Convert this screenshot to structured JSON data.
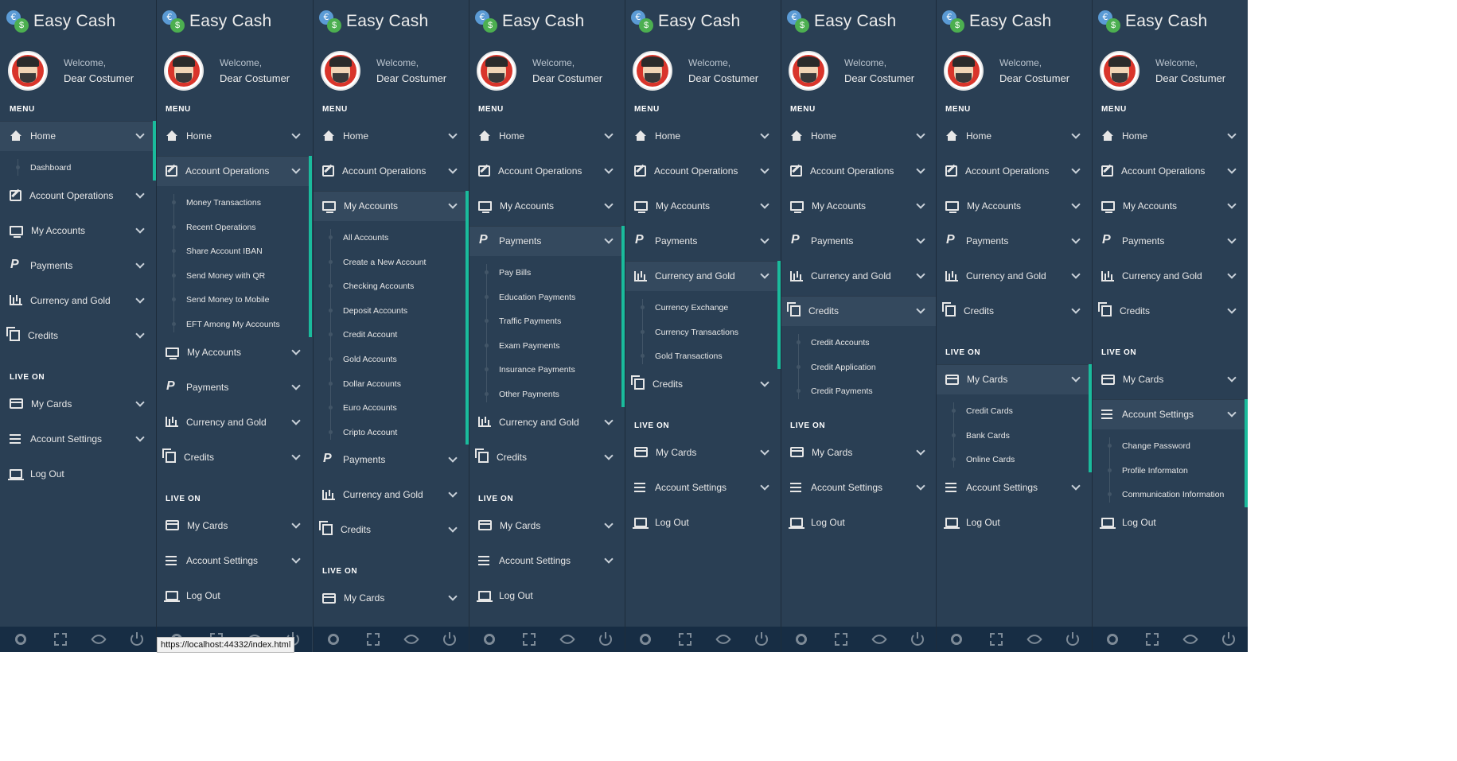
{
  "brand": {
    "name": "Easy Cash",
    "coin1": "€",
    "coin2": "$"
  },
  "user": {
    "welcome": "Welcome,",
    "name": "Dear Costumer"
  },
  "sections": {
    "menu": "MENU",
    "live_on": "LIVE ON"
  },
  "footer_icons": [
    "gear-icon",
    "fullscreen-icon",
    "eye-slash-icon",
    "power-icon"
  ],
  "status_url": "https://localhost:44332/index.html",
  "colors": {
    "sidebar_bg": "#2a3f54",
    "active_bg": "#34495e",
    "accent": "#1abb9c",
    "footer_bg": "#172d44"
  },
  "panels": [
    {
      "items": [
        {
          "type": "section",
          "text": "MENU"
        },
        {
          "type": "item",
          "icon": "home",
          "label": "Home",
          "active": true
        },
        {
          "type": "sub",
          "label": "Dashboard"
        },
        {
          "type": "item",
          "icon": "edit",
          "label": "Account Operations"
        },
        {
          "type": "item",
          "icon": "desk",
          "label": "My Accounts"
        },
        {
          "type": "item",
          "icon": "pay",
          "label": "Payments"
        },
        {
          "type": "item",
          "icon": "chart",
          "label": "Currency and Gold"
        },
        {
          "type": "item",
          "icon": "copy",
          "label": "Credits"
        },
        {
          "type": "section",
          "text": "LIVE ON"
        },
        {
          "type": "item",
          "icon": "card",
          "label": "My Cards"
        },
        {
          "type": "item",
          "icon": "bars",
          "label": "Account Settings"
        },
        {
          "type": "item",
          "icon": "logout",
          "label": "Log Out",
          "nochev": true
        }
      ]
    },
    {
      "items": [
        {
          "type": "section",
          "text": "MENU"
        },
        {
          "type": "item",
          "icon": "home",
          "label": "Home"
        },
        {
          "type": "item",
          "icon": "edit",
          "label": "Account Operations",
          "active": true
        },
        {
          "type": "sub",
          "label": "Money Transactions"
        },
        {
          "type": "sub",
          "label": "Recent Operations"
        },
        {
          "type": "sub",
          "label": "Share Account IBAN"
        },
        {
          "type": "sub",
          "label": "Send Money with QR"
        },
        {
          "type": "sub",
          "label": "Send Money to Mobile"
        },
        {
          "type": "sub",
          "label": "EFT Among My Accounts"
        },
        {
          "type": "item",
          "icon": "desk",
          "label": "My Accounts"
        },
        {
          "type": "item",
          "icon": "pay",
          "label": "Payments"
        },
        {
          "type": "item",
          "icon": "chart",
          "label": "Currency and Gold"
        },
        {
          "type": "item",
          "icon": "copy",
          "label": "Credits"
        },
        {
          "type": "section",
          "text": "LIVE ON"
        },
        {
          "type": "item",
          "icon": "card",
          "label": "My Cards"
        },
        {
          "type": "item",
          "icon": "bars",
          "label": "Account Settings"
        },
        {
          "type": "item",
          "icon": "logout",
          "label": "Log Out",
          "nochev": true
        }
      ]
    },
    {
      "items": [
        {
          "type": "section",
          "text": "MENU"
        },
        {
          "type": "item",
          "icon": "home",
          "label": "Home"
        },
        {
          "type": "item",
          "icon": "edit",
          "label": "Account Operations"
        },
        {
          "type": "item",
          "icon": "desk",
          "label": "My Accounts",
          "active": true
        },
        {
          "type": "sub",
          "label": "All Accounts"
        },
        {
          "type": "sub",
          "label": "Create a New Account"
        },
        {
          "type": "sub",
          "label": "Checking Accounts"
        },
        {
          "type": "sub",
          "label": "Deposit Accounts"
        },
        {
          "type": "sub",
          "label": "Credit Account"
        },
        {
          "type": "sub",
          "label": "Gold Accounts"
        },
        {
          "type": "sub",
          "label": "Dollar Accounts"
        },
        {
          "type": "sub",
          "label": "Euro Accounts"
        },
        {
          "type": "sub",
          "label": "Cripto Account"
        },
        {
          "type": "item",
          "icon": "pay",
          "label": "Payments"
        },
        {
          "type": "item",
          "icon": "chart",
          "label": "Currency and Gold"
        },
        {
          "type": "item",
          "icon": "copy",
          "label": "Credits"
        },
        {
          "type": "section",
          "text": "LIVE ON"
        },
        {
          "type": "item",
          "icon": "card",
          "label": "My Cards"
        }
      ]
    },
    {
      "items": [
        {
          "type": "section",
          "text": "MENU"
        },
        {
          "type": "item",
          "icon": "home",
          "label": "Home"
        },
        {
          "type": "item",
          "icon": "edit",
          "label": "Account Operations"
        },
        {
          "type": "item",
          "icon": "desk",
          "label": "My Accounts"
        },
        {
          "type": "item",
          "icon": "pay",
          "label": "Payments",
          "active": true
        },
        {
          "type": "sub",
          "label": "Pay Bills"
        },
        {
          "type": "sub",
          "label": "Education Payments"
        },
        {
          "type": "sub",
          "label": "Traffic Payments"
        },
        {
          "type": "sub",
          "label": "Exam Payments"
        },
        {
          "type": "sub",
          "label": "Insurance Payments"
        },
        {
          "type": "sub",
          "label": "Other Payments"
        },
        {
          "type": "item",
          "icon": "chart",
          "label": "Currency and Gold"
        },
        {
          "type": "item",
          "icon": "copy",
          "label": "Credits"
        },
        {
          "type": "section",
          "text": "LIVE ON"
        },
        {
          "type": "item",
          "icon": "card",
          "label": "My Cards"
        },
        {
          "type": "item",
          "icon": "bars",
          "label": "Account Settings"
        },
        {
          "type": "item",
          "icon": "logout",
          "label": "Log Out",
          "nochev": true
        }
      ]
    },
    {
      "items": [
        {
          "type": "section",
          "text": "MENU"
        },
        {
          "type": "item",
          "icon": "home",
          "label": "Home"
        },
        {
          "type": "item",
          "icon": "edit",
          "label": "Account Operations"
        },
        {
          "type": "item",
          "icon": "desk",
          "label": "My Accounts"
        },
        {
          "type": "item",
          "icon": "pay",
          "label": "Payments"
        },
        {
          "type": "item",
          "icon": "chart",
          "label": "Currency and Gold",
          "active": true
        },
        {
          "type": "sub",
          "label": "Currency Exchange"
        },
        {
          "type": "sub",
          "label": "Currency Transactions"
        },
        {
          "type": "sub",
          "label": "Gold Transactions"
        },
        {
          "type": "item",
          "icon": "copy",
          "label": "Credits"
        },
        {
          "type": "section",
          "text": "LIVE ON"
        },
        {
          "type": "item",
          "icon": "card",
          "label": "My Cards"
        },
        {
          "type": "item",
          "icon": "bars",
          "label": "Account Settings"
        },
        {
          "type": "item",
          "icon": "logout",
          "label": "Log Out",
          "nochev": true
        }
      ]
    },
    {
      "items": [
        {
          "type": "section",
          "text": "MENU"
        },
        {
          "type": "item",
          "icon": "home",
          "label": "Home"
        },
        {
          "type": "item",
          "icon": "edit",
          "label": "Account Operations"
        },
        {
          "type": "item",
          "icon": "desk",
          "label": "My Accounts"
        },
        {
          "type": "item",
          "icon": "pay",
          "label": "Payments"
        },
        {
          "type": "item",
          "icon": "chart",
          "label": "Currency and Gold"
        },
        {
          "type": "item",
          "icon": "copy",
          "label": "Credits",
          "active": true
        },
        {
          "type": "sub",
          "label": "Credit Accounts"
        },
        {
          "type": "sub",
          "label": "Credit Application"
        },
        {
          "type": "sub",
          "label": "Credit Payments"
        },
        {
          "type": "section",
          "text": "LIVE ON"
        },
        {
          "type": "item",
          "icon": "card",
          "label": "My Cards"
        },
        {
          "type": "item",
          "icon": "bars",
          "label": "Account Settings"
        },
        {
          "type": "item",
          "icon": "logout",
          "label": "Log Out",
          "nochev": true
        }
      ]
    },
    {
      "items": [
        {
          "type": "section",
          "text": "MENU"
        },
        {
          "type": "item",
          "icon": "home",
          "label": "Home"
        },
        {
          "type": "item",
          "icon": "edit",
          "label": "Account Operations"
        },
        {
          "type": "item",
          "icon": "desk",
          "label": "My Accounts"
        },
        {
          "type": "item",
          "icon": "pay",
          "label": "Payments"
        },
        {
          "type": "item",
          "icon": "chart",
          "label": "Currency and Gold"
        },
        {
          "type": "item",
          "icon": "copy",
          "label": "Credits"
        },
        {
          "type": "section",
          "text": "LIVE ON"
        },
        {
          "type": "item",
          "icon": "card",
          "label": "My Cards",
          "active": true
        },
        {
          "type": "sub",
          "label": "Credit Cards"
        },
        {
          "type": "sub",
          "label": "Bank Cards"
        },
        {
          "type": "sub",
          "label": "Online Cards"
        },
        {
          "type": "item",
          "icon": "bars",
          "label": "Account Settings"
        },
        {
          "type": "item",
          "icon": "logout",
          "label": "Log Out",
          "nochev": true
        }
      ]
    },
    {
      "items": [
        {
          "type": "section",
          "text": "MENU"
        },
        {
          "type": "item",
          "icon": "home",
          "label": "Home"
        },
        {
          "type": "item",
          "icon": "edit",
          "label": "Account Operations"
        },
        {
          "type": "item",
          "icon": "desk",
          "label": "My Accounts"
        },
        {
          "type": "item",
          "icon": "pay",
          "label": "Payments"
        },
        {
          "type": "item",
          "icon": "chart",
          "label": "Currency and Gold"
        },
        {
          "type": "item",
          "icon": "copy",
          "label": "Credits"
        },
        {
          "type": "section",
          "text": "LIVE ON"
        },
        {
          "type": "item",
          "icon": "card",
          "label": "My Cards"
        },
        {
          "type": "item",
          "icon": "bars",
          "label": "Account Settings",
          "active": true
        },
        {
          "type": "sub",
          "label": "Change Password"
        },
        {
          "type": "sub",
          "label": "Profile Informaton"
        },
        {
          "type": "sub",
          "label": "Communication Information"
        },
        {
          "type": "item",
          "icon": "logout",
          "label": "Log Out",
          "nochev": true
        }
      ]
    }
  ]
}
